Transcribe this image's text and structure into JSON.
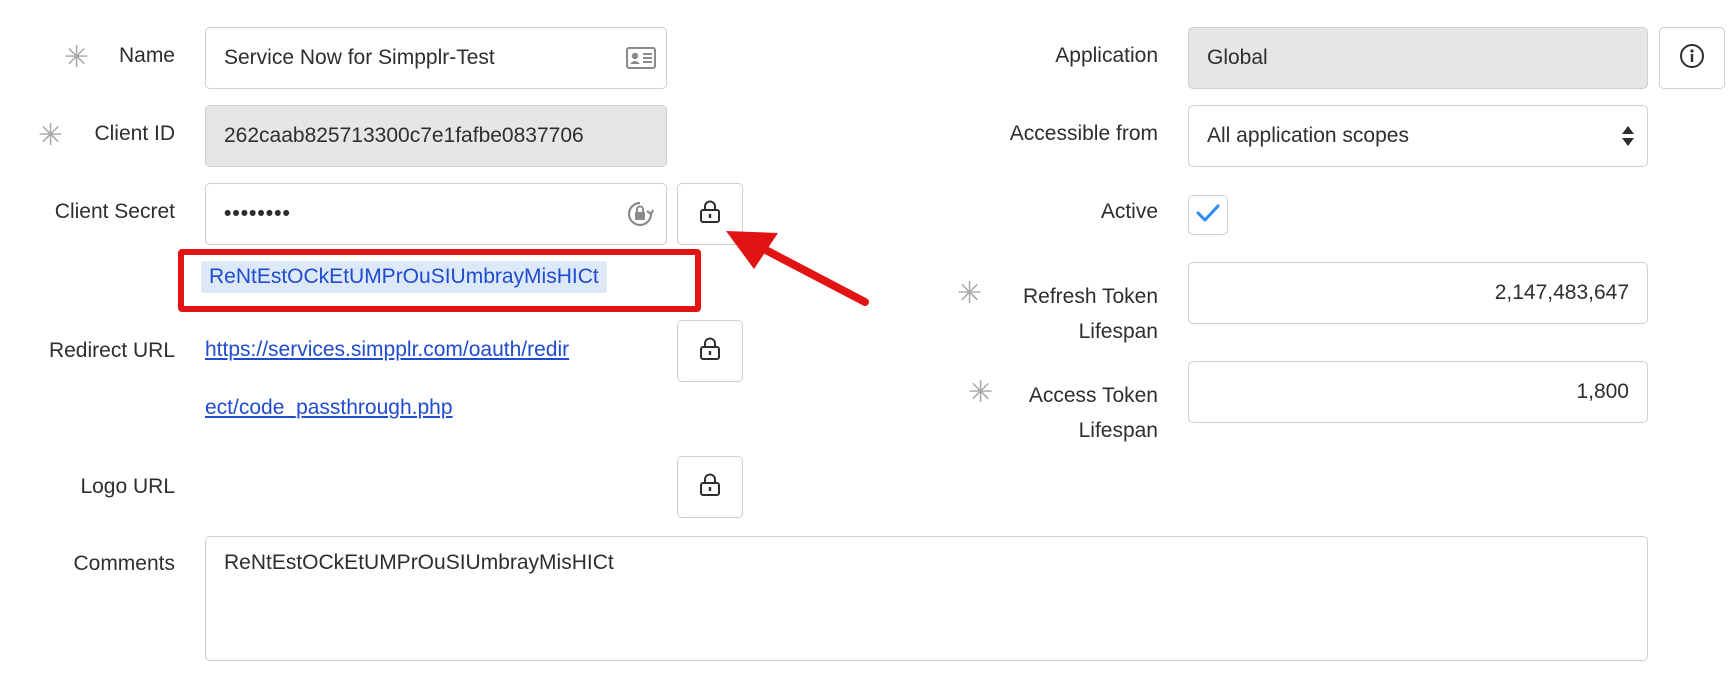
{
  "form": {
    "name": {
      "label": "Name",
      "value": "Service Now for Simpplr-Test"
    },
    "client_id": {
      "label": "Client ID",
      "value": "262caab825713300c7e1fafbe0837706"
    },
    "client_secret": {
      "label": "Client Secret",
      "value": "••••••••",
      "revealed_value": "ReNtEstOCkEtUMPrOuSIUmbrayMisHICt"
    },
    "redirect_url": {
      "label": "Redirect URL",
      "line1": "https://services.simpplr.com/oauth/redir",
      "line2": "ect/code_passthrough.php"
    },
    "logo_url": {
      "label": "Logo URL"
    },
    "comments": {
      "label": "Comments",
      "value": "ReNtEstOCkEtUMPrOuSIUmbrayMisHICt"
    },
    "application": {
      "label": "Application",
      "value": "Global"
    },
    "accessible_from": {
      "label": "Accessible from",
      "value": "All application scopes"
    },
    "active": {
      "label": "Active",
      "checked": true
    },
    "refresh_token": {
      "label_line1": "Refresh Token",
      "label_line2": "Lifespan",
      "value": "2,147,483,647"
    },
    "access_token": {
      "label_line1": "Access Token",
      "label_line2": "Lifespan",
      "value": "1,800"
    }
  },
  "required_marker": "*",
  "icons": {
    "contact_card": "contact-card-icon",
    "password_reveal": "key-lock-icon",
    "lock": "lock-icon",
    "info": "info-icon",
    "select_arrows": "up-down-arrows-icon",
    "check": "checkmark-icon"
  },
  "colors": {
    "accent_link": "#1f4bd0",
    "annotation_red": "#e21313",
    "readonly_bg": "#e6e6e6",
    "check_blue": "#2a8bf2"
  }
}
